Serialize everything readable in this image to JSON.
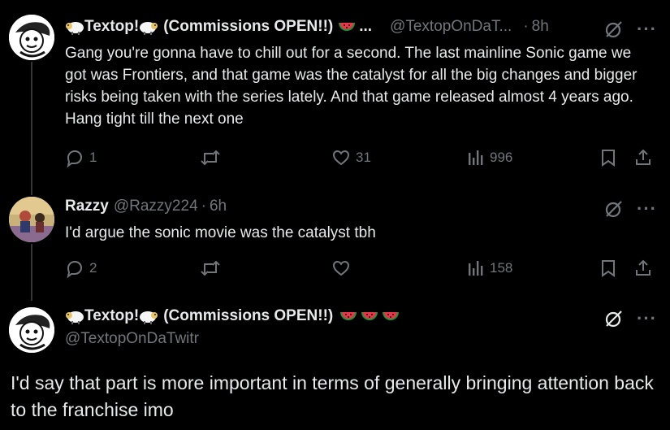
{
  "tweets": [
    {
      "author": "Textop!",
      "author_suffix": "(Commissions OPEN!!)",
      "truncation": "...",
      "handle": "@TextopOnDaT...",
      "time_sep": "·",
      "time": "8h",
      "text": "Gang you're gonna have to chill out for a second. The last mainline Sonic game we got was Frontiers, and that game was the catalyst for all the big changes and bigger risks being taken with the series lately. And that game released almost 4 years ago. Hang tight till the next one",
      "replies": "1",
      "retweets": "",
      "likes": "31",
      "views": "996"
    },
    {
      "author": "Razzy",
      "handle": "@Razzy224",
      "time_sep": "·",
      "time": "6h",
      "text": "I'd argue the sonic movie was the catalyst tbh",
      "replies": "2",
      "retweets": "",
      "likes": "",
      "views": "158"
    },
    {
      "author": "Textop!",
      "author_suffix": "(Commissions OPEN!!)",
      "handle": "@TextopOnDaTwitr",
      "text": "I'd say that part is more important in terms of generally bringing attention back to the franchise imo"
    }
  ],
  "more_label": "···",
  "icons": [
    "reply-icon",
    "retweet-icon",
    "like-icon",
    "views-icon",
    "bookmark-icon",
    "share-icon",
    "grok-icon",
    "sheep-emoji",
    "watermelon-emoji",
    "more-icon"
  ],
  "colors": {
    "background": "#000000",
    "text": "#e7e9ea",
    "muted": "#71767b",
    "line": "#333639"
  }
}
